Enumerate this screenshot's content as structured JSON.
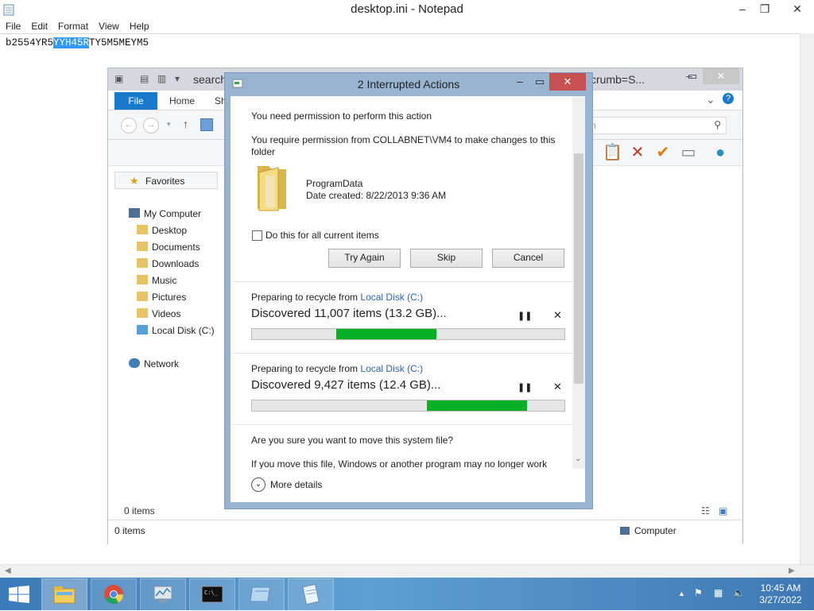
{
  "notepad": {
    "title": "desktop.ini - Notepad",
    "menu": [
      "File",
      "Edit",
      "Format",
      "View",
      "Help"
    ],
    "text_before": "b2554YR5",
    "text_selected": "YYH45R",
    "text_after": "TY5M5MEYM5"
  },
  "explorer": {
    "title_left": "search",
    "title_right": "xcrumb=S...",
    "tabs": {
      "file": "File",
      "home": "Home",
      "share": "Sh"
    },
    "search_placeholder": "rch",
    "nav": {
      "favorites": "Favorites",
      "my_computer": "My Computer",
      "items": [
        "Desktop",
        "Documents",
        "Downloads",
        "Music",
        "Pictures",
        "Videos",
        "Local Disk (C:)"
      ],
      "network": "Network"
    },
    "items_count_inner": "0 items",
    "status_left": "0 items",
    "status_right": "Computer"
  },
  "dialog": {
    "title": "2 Interrupted Actions",
    "heading": "You need permission to perform this action",
    "message": "You require permission from COLLABNET\\VM4 to make changes to this folder",
    "folder_name": "ProgramData",
    "date_created": "Date created: 8/22/2013 9:36 AM",
    "checkbox_label": "Do this for all current items",
    "buttons": {
      "try_again": "Try Again",
      "skip": "Skip",
      "cancel": "Cancel"
    },
    "op1": {
      "prefix": "Preparing to recycle from ",
      "link": "Local Disk (C:)",
      "status": "Discovered 11,007 items (13.2 GB)...",
      "progress_fill_start": 0.27,
      "progress_fill_end": 0.59
    },
    "op2": {
      "prefix": "Preparing to recycle from ",
      "link": "Local Disk (C:)",
      "status": "Discovered 9,427 items (12.4 GB)...",
      "progress_fill_start": 0.56,
      "progress_fill_end": 0.88
    },
    "confirm": "Are you sure you want to move this system file?",
    "confirm_cut": "If you move this file, Windows or another program may no longer work",
    "more_details": "More details"
  },
  "taskbar": {
    "time": "10:45 AM",
    "date": "3/27/2022"
  },
  "colors": {
    "accent": "#1979ca",
    "progress": "#06b025",
    "close": "#c75050"
  }
}
